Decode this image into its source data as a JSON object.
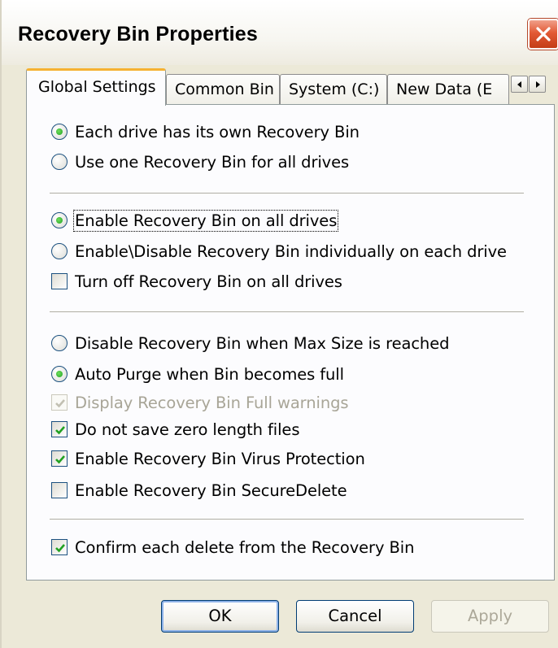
{
  "window": {
    "title": "Recovery Bin Properties",
    "close_icon": "close-icon"
  },
  "tabs": [
    {
      "label": "Global Settings",
      "active": true
    },
    {
      "label": "Common Bin",
      "active": false
    },
    {
      "label": "System (C:)",
      "active": false
    },
    {
      "label": "New Data (E",
      "active": false
    }
  ],
  "tab_scroll": {
    "left_icon": "arrow-left-icon",
    "right_icon": "arrow-right-icon"
  },
  "groups": {
    "bin_mode": [
      {
        "label": "Each drive has its own Recovery Bin",
        "type": "radio",
        "checked": true
      },
      {
        "label": "Use one Recovery Bin for all drives",
        "type": "radio",
        "checked": false
      }
    ],
    "enable": [
      {
        "label": "Enable Recovery Bin on all drives",
        "type": "radio",
        "checked": true
      },
      {
        "label": "Enable\\Disable Recovery Bin individually on each drive",
        "type": "radio",
        "checked": false
      },
      {
        "label": "Turn off Recovery Bin on all drives",
        "type": "checkbox",
        "checked": false
      }
    ],
    "full": [
      {
        "label": "Disable Recovery Bin when Max Size is reached",
        "type": "radio",
        "checked": false
      },
      {
        "label": "Auto Purge when Bin becomes full",
        "type": "radio",
        "checked": true
      },
      {
        "label": "Display Recovery Bin Full warnings",
        "type": "checkbox",
        "checked": true,
        "disabled": true
      },
      {
        "label": "Do not save zero length files",
        "type": "checkbox",
        "checked": true
      },
      {
        "label": "Enable Recovery Bin Virus Protection",
        "type": "checkbox",
        "checked": true
      },
      {
        "label": "Enable Recovery Bin SecureDelete",
        "type": "checkbox",
        "checked": false
      }
    ],
    "confirm": [
      {
        "label": "Confirm each delete from the Recovery Bin",
        "type": "checkbox",
        "checked": true
      }
    ]
  },
  "buttons": {
    "ok": "OK",
    "cancel": "Cancel",
    "apply": "Apply"
  }
}
